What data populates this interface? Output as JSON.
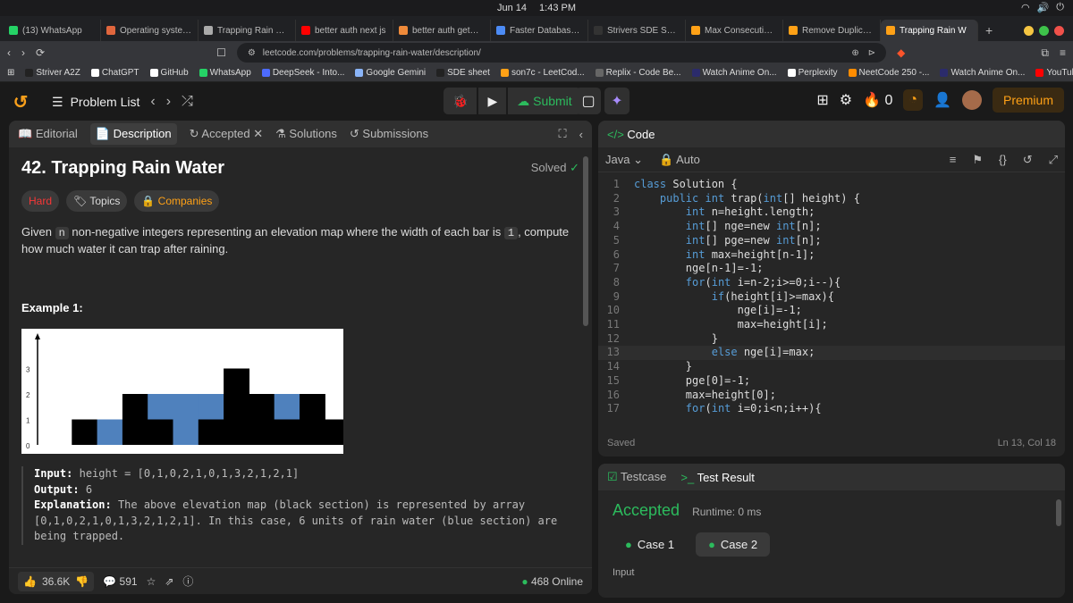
{
  "os": {
    "date": "Jun 14",
    "time": "1:43 PM"
  },
  "browser": {
    "tabs": [
      {
        "label": "(13) WhatsApp",
        "color": "#25d366"
      },
      {
        "label": "Operating systems",
        "color": "#e0663d"
      },
      {
        "label": "Trapping Rain Water",
        "color": "#aaaaaa"
      },
      {
        "label": "better auth next js",
        "color": "#ff0000"
      },
      {
        "label": "better auth getSess",
        "color": "#ef8a3a"
      },
      {
        "label": "Faster Database Re",
        "color": "#4c8bf5"
      },
      {
        "label": "Strivers SDE Sheet",
        "color": "#333333"
      },
      {
        "label": "Max Consecutive O",
        "color": "#ffa116"
      },
      {
        "label": "Remove Duplicates",
        "color": "#ffa116"
      },
      {
        "label": "Trapping Rain W",
        "color": "#ffa116",
        "active": true
      }
    ],
    "url": "leetcode.com/problems/trapping-rain-water/description/",
    "bookmarks": [
      {
        "label": "Striver A2Z",
        "color": "#222222"
      },
      {
        "label": "ChatGPT",
        "color": "#ffffff"
      },
      {
        "label": "GitHub",
        "color": "#ffffff"
      },
      {
        "label": "WhatsApp",
        "color": "#25d366"
      },
      {
        "label": "DeepSeek - Into...",
        "color": "#4d6bfe"
      },
      {
        "label": "Google Gemini",
        "color": "#8ab4f8"
      },
      {
        "label": "SDE sheet",
        "color": "#222222"
      },
      {
        "label": "son7c - LeetCod...",
        "color": "#ffa116"
      },
      {
        "label": "Replix - Code Be...",
        "color": "#666666"
      },
      {
        "label": "Watch Anime On...",
        "color": "#2b2b6b"
      },
      {
        "label": "Perplexity",
        "color": "#ffffff"
      },
      {
        "label": "NeetCode 250 -...",
        "color": "#ff8c00"
      },
      {
        "label": "Watch Anime On...",
        "color": "#2b2b6b"
      },
      {
        "label": "YouTube",
        "color": "#ff0000"
      }
    ]
  },
  "lcnav": {
    "problem_list": "Problem List",
    "submit": "Submit",
    "streak": "0",
    "premium": "Premium"
  },
  "desc_tabs": {
    "editorial": "Editorial",
    "description": "Description",
    "accepted": "Accepted",
    "solutions": "Solutions",
    "submissions": "Submissions"
  },
  "problem": {
    "title": "42. Trapping Rain Water",
    "solved": "Solved",
    "difficulty": "Hard",
    "topics": "Topics",
    "companies": "Companies",
    "text_pre": "Given ",
    "n": "n",
    "text_mid": " non-negative integers representing an elevation map where the width of each bar is ",
    "one": "1",
    "text_post": ", compute how much water it can trap after raining.",
    "example_title": "Example 1:",
    "input_label": "Input:",
    "input_value": "height = [0,1,0,2,1,0,1,3,2,1,2,1]",
    "output_label": "Output:",
    "output_value": "6",
    "expl_label": "Explanation:",
    "expl_value": "The above elevation map (black section) is represented by array [0,1,0,2,1,0,1,3,2,1,2,1]. In this case, 6 units of rain water (blue section) are being trapped."
  },
  "chart_data": {
    "type": "bar",
    "heights": [
      0,
      1,
      0,
      2,
      1,
      0,
      1,
      3,
      2,
      1,
      2,
      1
    ],
    "water": [
      0,
      0,
      1,
      0,
      1,
      2,
      1,
      0,
      0,
      1,
      0,
      0
    ],
    "yticks": [
      "0",
      "1",
      "2",
      "3"
    ],
    "colors": {
      "bar": "#000000",
      "water": "#4f81bd"
    }
  },
  "footer": {
    "likes": "36.6K",
    "comments": "591",
    "online": "468 Online"
  },
  "code_panel": {
    "title": "Code",
    "lang": "Java",
    "mode": "Auto",
    "status": "Saved",
    "cursor": "Ln 13, Col 18",
    "lines": [
      "class Solution {",
      "    public int trap(int[] height) {",
      "        int n=height.length;",
      "        int[] nge=new int[n];",
      "        int[] pge=new int[n];",
      "        int max=height[n-1];",
      "        nge[n-1]=-1;",
      "        for(int i=n-2;i>=0;i--){",
      "            if(height[i]>=max){",
      "                nge[i]=-1;",
      "                max=height[i];",
      "            }",
      "            else nge[i]=max;",
      "        }",
      "        pge[0]=-1;",
      "        max=height[0];",
      "        for(int i=0;i<n;i++){"
    ]
  },
  "result": {
    "testcase": "Testcase",
    "test_result": "Test Result",
    "status": "Accepted",
    "runtime": "Runtime: 0 ms",
    "case1": "Case 1",
    "case2": "Case 2",
    "input_label": "Input"
  }
}
